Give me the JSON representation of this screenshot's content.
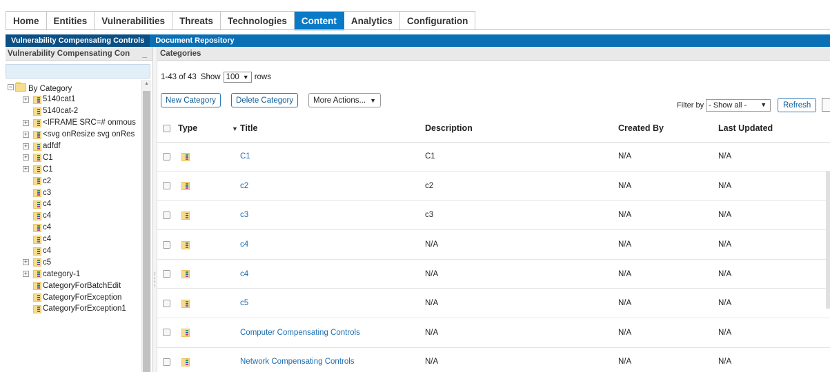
{
  "topnav": {
    "tabs": [
      {
        "label": "Home",
        "name": "tab-home",
        "active": false
      },
      {
        "label": "Entities",
        "name": "tab-entities",
        "active": false
      },
      {
        "label": "Vulnerabilities",
        "name": "tab-vulnerabilities",
        "active": false
      },
      {
        "label": "Threats",
        "name": "tab-threats",
        "active": false
      },
      {
        "label": "Technologies",
        "name": "tab-technologies",
        "active": false
      },
      {
        "label": "Content",
        "name": "tab-content",
        "active": true
      },
      {
        "label": "Analytics",
        "name": "tab-analytics",
        "active": false
      },
      {
        "label": "Configuration",
        "name": "tab-configuration",
        "active": false
      }
    ]
  },
  "subnav": {
    "tabs": [
      {
        "label": "Vulnerability Compensating Controls",
        "active": true
      },
      {
        "label": "Document Repository",
        "active": false
      }
    ]
  },
  "left_panel": {
    "title": "Vulnerability Compensating Con",
    "minimize": "_",
    "tree": [
      {
        "label": "By Category",
        "expandable": true,
        "expanded": true,
        "root": true
      },
      {
        "label": "5140cat1",
        "expandable": true
      },
      {
        "label": "5140cat-2",
        "expandable": false
      },
      {
        "label": "<IFRAME SRC=# onmous",
        "expandable": true
      },
      {
        "label": "<svg onResize svg onRes",
        "expandable": true
      },
      {
        "label": "adfdf",
        "expandable": true
      },
      {
        "label": "C1",
        "expandable": true
      },
      {
        "label": "C1",
        "expandable": true
      },
      {
        "label": "c2",
        "expandable": false
      },
      {
        "label": "c3",
        "expandable": false
      },
      {
        "label": "c4",
        "expandable": false
      },
      {
        "label": "c4",
        "expandable": false
      },
      {
        "label": "c4",
        "expandable": false
      },
      {
        "label": "c4",
        "expandable": false
      },
      {
        "label": "c4",
        "expandable": false
      },
      {
        "label": "c5",
        "expandable": true
      },
      {
        "label": "category-1",
        "expandable": true
      },
      {
        "label": "CategoryForBatchEdit",
        "expandable": false
      },
      {
        "label": "CategoryForException",
        "expandable": false
      },
      {
        "label": "CategoryForException1",
        "expandable": false
      }
    ]
  },
  "right_panel": {
    "title": "Categories",
    "pager": {
      "range": "1-43 of 43",
      "show_label": "Show",
      "rows_value": "100",
      "rows_label": "rows"
    },
    "buttons": {
      "new_category": "New Category",
      "delete_category": "Delete Category",
      "more_actions": "More Actions..."
    },
    "filter": {
      "label": "Filter by",
      "value": "- Show all -"
    },
    "refresh": "Refresh",
    "columns": {
      "type": "Type",
      "title": "Title",
      "description": "Description",
      "created_by": "Created By",
      "last_updated": "Last Updated"
    },
    "rows": [
      {
        "title": "C1",
        "description": "C1",
        "created_by": "N/A",
        "last_updated": "N/A"
      },
      {
        "title": "c2",
        "description": "c2",
        "created_by": "N/A",
        "last_updated": "N/A"
      },
      {
        "title": "c3",
        "description": "c3",
        "created_by": "N/A",
        "last_updated": "N/A"
      },
      {
        "title": "c4",
        "description": "N/A",
        "created_by": "N/A",
        "last_updated": "N/A"
      },
      {
        "title": "c4",
        "description": "N/A",
        "created_by": "N/A",
        "last_updated": "N/A"
      },
      {
        "title": "c5",
        "description": "N/A",
        "created_by": "N/A",
        "last_updated": "N/A"
      },
      {
        "title": "Computer Compensating Controls",
        "description": "N/A",
        "created_by": "N/A",
        "last_updated": "N/A"
      },
      {
        "title": "Network Compensating Controls",
        "description": "N/A",
        "created_by": "N/A",
        "last_updated": "N/A"
      }
    ]
  },
  "colors": {
    "accent": "#0a7ac7",
    "subnav": "#0b6fb5",
    "link": "#1c6db2"
  },
  "icons": {
    "category": "category-icon",
    "folder": "folder-icon",
    "sort": "sort-desc-icon",
    "dropdown": "chevron-down-icon"
  }
}
